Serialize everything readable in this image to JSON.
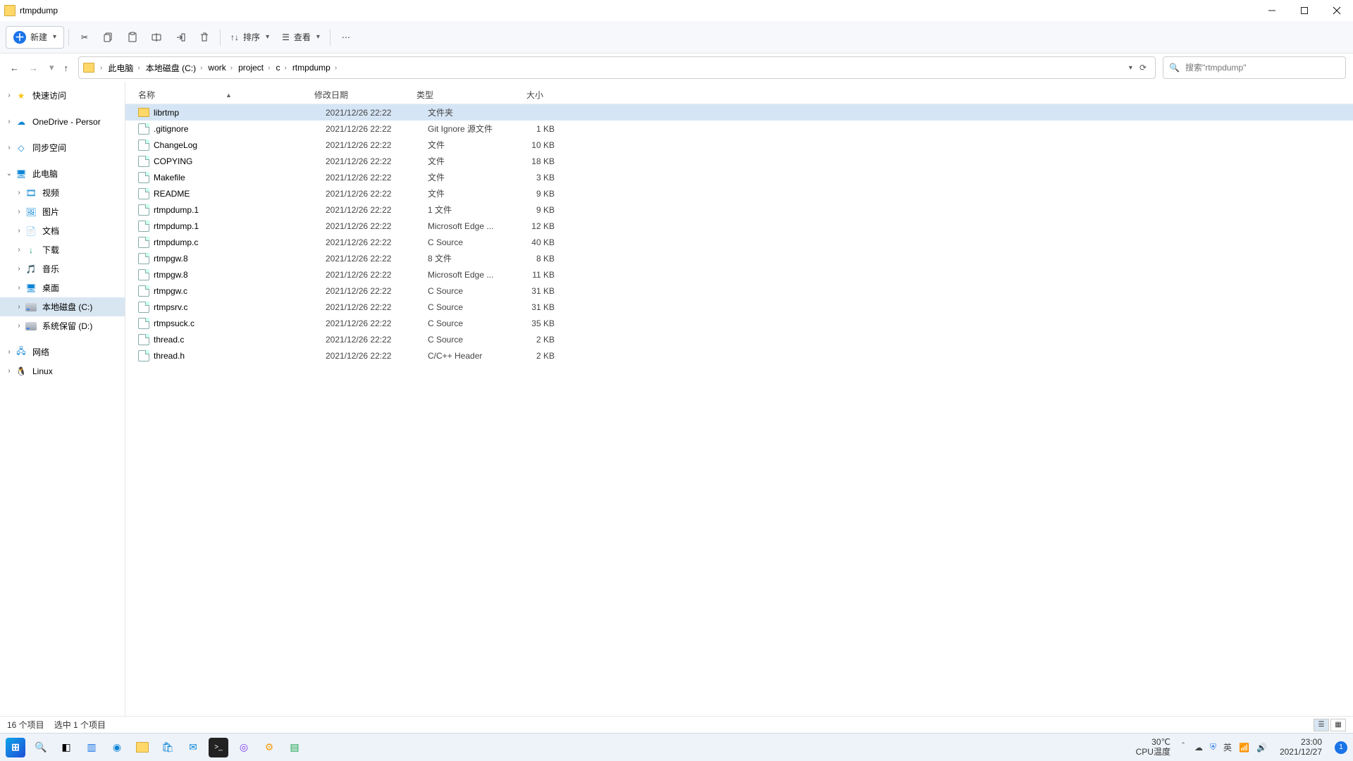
{
  "window": {
    "title": "rtmpdump"
  },
  "toolbar": {
    "new_label": "新建",
    "sort_label": "排序",
    "view_label": "查看"
  },
  "breadcrumbs": [
    "此电脑",
    "本地磁盘 (C:)",
    "work",
    "project",
    "c",
    "rtmpdump"
  ],
  "search": {
    "placeholder": "搜索\"rtmpdump\""
  },
  "sidebar": [
    {
      "label": "快速访问",
      "icon": "star",
      "chev": "right",
      "depth": 0
    },
    {
      "label": "OneDrive - Persor",
      "icon": "cloud",
      "chev": "right",
      "depth": 0
    },
    {
      "label": "同步空间",
      "icon": "sync",
      "chev": "right",
      "depth": 0
    },
    {
      "label": "此电脑",
      "icon": "pc",
      "chev": "down",
      "depth": 0
    },
    {
      "label": "视频",
      "icon": "video",
      "chev": "right",
      "depth": 1
    },
    {
      "label": "图片",
      "icon": "pic",
      "chev": "right",
      "depth": 1
    },
    {
      "label": "文档",
      "icon": "doc",
      "chev": "right",
      "depth": 1
    },
    {
      "label": "下载",
      "icon": "down",
      "chev": "right",
      "depth": 1
    },
    {
      "label": "音乐",
      "icon": "music",
      "chev": "right",
      "depth": 1
    },
    {
      "label": "桌面",
      "icon": "desk",
      "chev": "right",
      "depth": 1
    },
    {
      "label": "本地磁盘 (C:)",
      "icon": "drive",
      "chev": "right",
      "depth": 1,
      "selected": true
    },
    {
      "label": "系统保留 (D:)",
      "icon": "drive",
      "chev": "right",
      "depth": 1
    },
    {
      "label": "网络",
      "icon": "net",
      "chev": "right",
      "depth": 0
    },
    {
      "label": "Linux",
      "icon": "tux",
      "chev": "right",
      "depth": 0
    }
  ],
  "columns": {
    "name": "名称",
    "date": "修改日期",
    "type": "类型",
    "size": "大小"
  },
  "files": [
    {
      "name": "librtmp",
      "date": "2021/12/26 22:22",
      "type": "文件夹",
      "size": "",
      "kind": "folder",
      "selected": true
    },
    {
      "name": ".gitignore",
      "date": "2021/12/26 22:22",
      "type": "Git Ignore 源文件",
      "size": "1 KB",
      "kind": "file"
    },
    {
      "name": "ChangeLog",
      "date": "2021/12/26 22:22",
      "type": "文件",
      "size": "10 KB",
      "kind": "file"
    },
    {
      "name": "COPYING",
      "date": "2021/12/26 22:22",
      "type": "文件",
      "size": "18 KB",
      "kind": "file"
    },
    {
      "name": "Makefile",
      "date": "2021/12/26 22:22",
      "type": "文件",
      "size": "3 KB",
      "kind": "file"
    },
    {
      "name": "README",
      "date": "2021/12/26 22:22",
      "type": "文件",
      "size": "9 KB",
      "kind": "file"
    },
    {
      "name": "rtmpdump.1",
      "date": "2021/12/26 22:22",
      "type": "1 文件",
      "size": "9 KB",
      "kind": "file"
    },
    {
      "name": "rtmpdump.1",
      "date": "2021/12/26 22:22",
      "type": "Microsoft Edge ...",
      "size": "12 KB",
      "kind": "file"
    },
    {
      "name": "rtmpdump.c",
      "date": "2021/12/26 22:22",
      "type": "C Source",
      "size": "40 KB",
      "kind": "file"
    },
    {
      "name": "rtmpgw.8",
      "date": "2021/12/26 22:22",
      "type": "8 文件",
      "size": "8 KB",
      "kind": "file"
    },
    {
      "name": "rtmpgw.8",
      "date": "2021/12/26 22:22",
      "type": "Microsoft Edge ...",
      "size": "11 KB",
      "kind": "file"
    },
    {
      "name": "rtmpgw.c",
      "date": "2021/12/26 22:22",
      "type": "C Source",
      "size": "31 KB",
      "kind": "file"
    },
    {
      "name": "rtmpsrv.c",
      "date": "2021/12/26 22:22",
      "type": "C Source",
      "size": "31 KB",
      "kind": "file"
    },
    {
      "name": "rtmpsuck.c",
      "date": "2021/12/26 22:22",
      "type": "C Source",
      "size": "35 KB",
      "kind": "file"
    },
    {
      "name": "thread.c",
      "date": "2021/12/26 22:22",
      "type": "C Source",
      "size": "2 KB",
      "kind": "file"
    },
    {
      "name": "thread.h",
      "date": "2021/12/26 22:22",
      "type": "C/C++ Header",
      "size": "2 KB",
      "kind": "file"
    }
  ],
  "status": {
    "count": "16 个项目",
    "selected": "选中 1 个项目"
  },
  "taskbar": {
    "weather_temp": "30℃",
    "weather_label": "CPU温度",
    "ime": "英",
    "time": "23:00",
    "date": "2021/12/27",
    "notif_count": "1"
  }
}
